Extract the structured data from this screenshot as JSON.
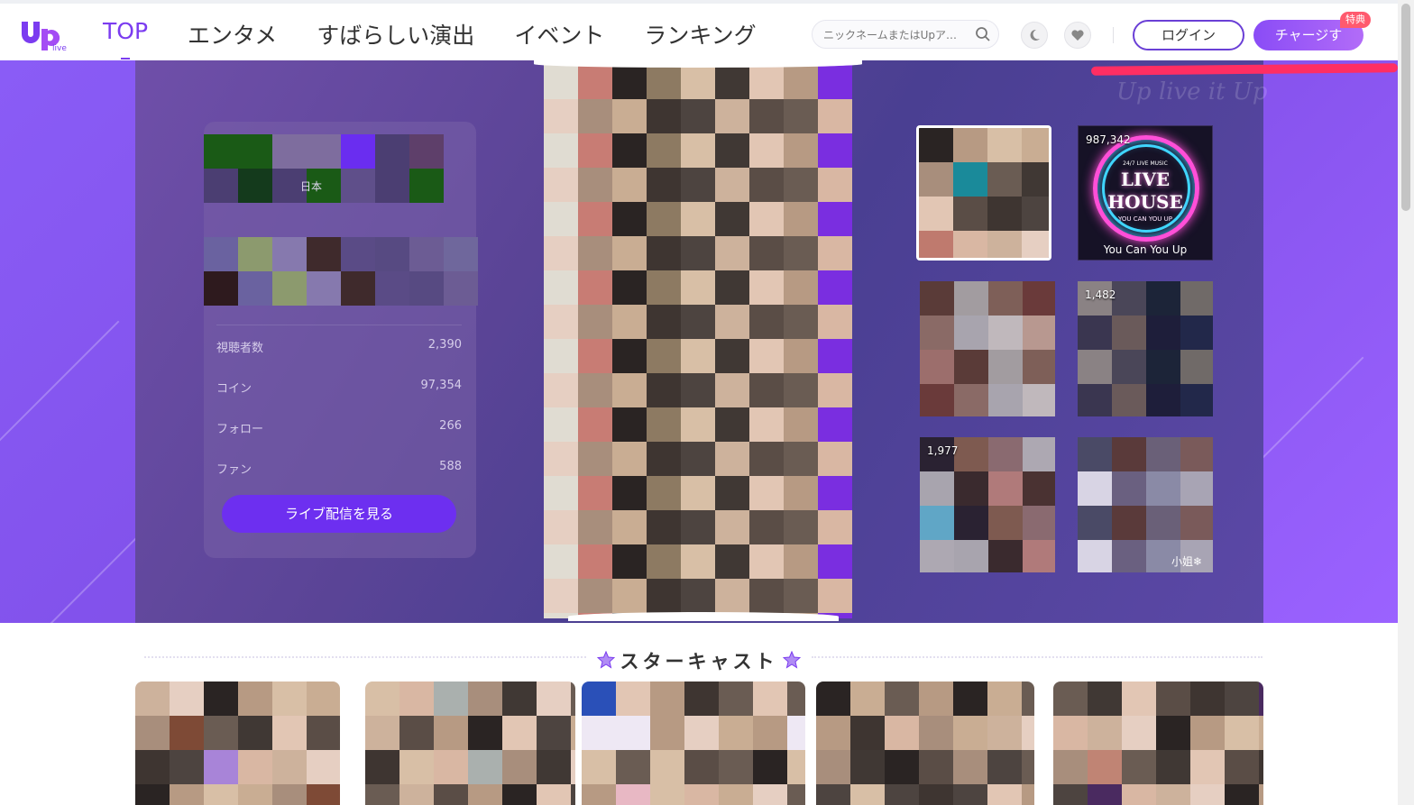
{
  "brand": {
    "logo_text": "up",
    "logo_sub": "live",
    "accent": "#7b3cf0"
  },
  "nav": {
    "items": [
      {
        "label": "TOP",
        "active": true
      },
      {
        "label": "エンタメ",
        "active": false
      },
      {
        "label": "すばらしい演出",
        "active": false
      },
      {
        "label": "イベント",
        "active": false
      },
      {
        "label": "ランキング",
        "active": false
      }
    ]
  },
  "search": {
    "placeholder": "ニックネームまたはUpア…",
    "icon": "search-icon"
  },
  "header_icons": [
    "moon-icon",
    "heart-icon"
  ],
  "auth": {
    "login_label": "ログイン",
    "charge_label": "チャージす",
    "charge_badge": "特典"
  },
  "hero": {
    "watermark": "Up live it Up",
    "profile": {
      "country_fragment": "日本",
      "stats": [
        {
          "label": "視聴者数",
          "value": "2,390"
        },
        {
          "label": "コイン",
          "value": "97,354"
        },
        {
          "label": "フォロー",
          "value": "266"
        },
        {
          "label": "ファン",
          "value": "588"
        }
      ],
      "watch_button": "ライブ配信を見る"
    },
    "thumbnails": [
      {
        "id": "t1",
        "count": "",
        "name": "",
        "selected": true
      },
      {
        "id": "t2",
        "count": "987,342",
        "name": "You Can You Up",
        "selected": false,
        "livehouse": {
          "sub": "24/7 LIVE MUSIC",
          "line1": "LIVE",
          "line2": "HOUSE",
          "tag": "YOU CAN YOU UP"
        }
      },
      {
        "id": "t3",
        "count": "",
        "name": "",
        "selected": false
      },
      {
        "id": "t4",
        "count": "1,482",
        "name": "",
        "selected": false
      },
      {
        "id": "t5",
        "count": "1,977",
        "name": "",
        "selected": false
      },
      {
        "id": "t6",
        "count": "",
        "name": "小姐❄",
        "selected": false
      }
    ]
  },
  "star_cast": {
    "title": "スターキャスト",
    "icon": "star-icon"
  }
}
